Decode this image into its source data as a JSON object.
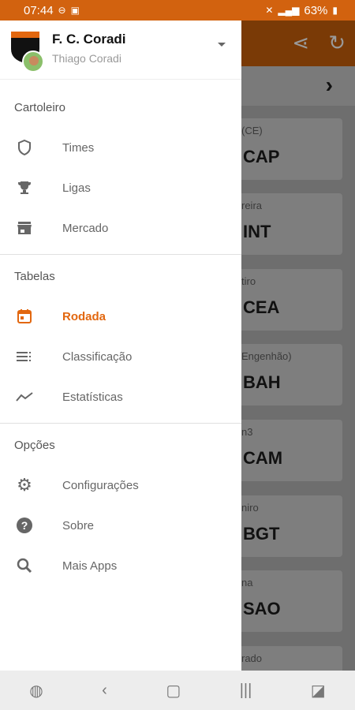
{
  "status": {
    "time": "07:44",
    "battery": "63%"
  },
  "background_app": {
    "cards": [
      {
        "stadium": "(CE)",
        "team": "CAP"
      },
      {
        "stadium": "reira",
        "team": "INT"
      },
      {
        "stadium": "tiro",
        "team": "CEA"
      },
      {
        "stadium": "Engenhão)",
        "team": "BAH"
      },
      {
        "stadium": "n3",
        "team": "CAM"
      },
      {
        "stadium": "niro",
        "team": "BGT"
      },
      {
        "stadium": "na",
        "team": "SAO"
      },
      {
        "stadium": "rado",
        "team": ""
      }
    ]
  },
  "drawer": {
    "team_name": "F. C. Coradi",
    "user_name": "Thiago Coradi",
    "sections": {
      "cartoleiro": {
        "title": "Cartoleiro",
        "items": [
          {
            "label": "Times",
            "icon": "shield-icon"
          },
          {
            "label": "Ligas",
            "icon": "trophy-icon"
          },
          {
            "label": "Mercado",
            "icon": "store-icon"
          }
        ]
      },
      "tabelas": {
        "title": "Tabelas",
        "items": [
          {
            "label": "Rodada",
            "icon": "calendar-icon",
            "active": true
          },
          {
            "label": "Classificação",
            "icon": "list-icon"
          },
          {
            "label": "Estatísticas",
            "icon": "trending-icon"
          }
        ]
      },
      "opcoes": {
        "title": "Opções",
        "items": [
          {
            "label": "Configurações",
            "icon": "gear-icon"
          },
          {
            "label": "Sobre",
            "icon": "help-icon"
          },
          {
            "label": "Mais Apps",
            "icon": "search-icon"
          }
        ]
      }
    }
  },
  "colors": {
    "accent": "#e2670f",
    "statusbar": "#d2620f"
  }
}
